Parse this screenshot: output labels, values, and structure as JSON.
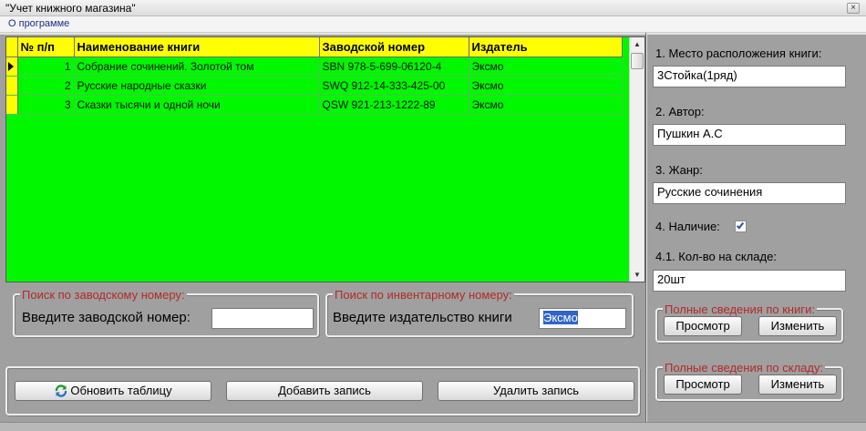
{
  "window": {
    "title": "\"Учет книжного магазина\"",
    "close_glyph": "×"
  },
  "menu": {
    "items": [
      "О программе"
    ]
  },
  "grid": {
    "columns": [
      "№ п/п",
      "Наименование книги",
      "Заводской номер",
      "Издатель"
    ],
    "rows": [
      [
        "1",
        "Собрание сочинений. Золотой том",
        "SBN 978-5-699-06120-4",
        "Эксмо"
      ],
      [
        "2",
        "Русские народные сказки",
        "SWQ 912-14-333-425-00",
        "Эксмо"
      ],
      [
        "3",
        "Сказки тысячи и одной ночи",
        "QSW 921-213-1222-89",
        "Эксмо"
      ]
    ],
    "colors": {
      "background": "#00f700",
      "header": "#ffff00"
    }
  },
  "search_factory": {
    "legend": "Поиск по заводскому номеру:",
    "label": "Введите заводской номер:",
    "value": ""
  },
  "search_publisher": {
    "legend": "Поиск по инвентарному номеру:",
    "label": "Введите издательство книги",
    "value": "Эксмо"
  },
  "actions": {
    "refresh": "Обновить таблицу",
    "add": "Добавить запись",
    "delete": "Удалить запись"
  },
  "details": {
    "location_label": "1. Место расположения книги:",
    "location_value": "3Стойка(1ряд)",
    "author_label": "2. Автор:",
    "author_value": "Пушкин А.С",
    "genre_label": "3. Жанр:",
    "genre_value": "Русские сочинения",
    "availability_label": "4. Наличие:",
    "availability_checked": true,
    "stock_label": "4.1. Кол-во на складе:",
    "stock_value": "20шт"
  },
  "book_info": {
    "legend": "Полные сведения по книги:",
    "view": "Просмотр",
    "edit": "Изменить"
  },
  "stock_info": {
    "legend": "Полные сведения по складу:",
    "view": "Просмотр",
    "edit": "Изменить"
  },
  "icons": {
    "refresh": "refresh-icon",
    "row_pointer": "row-pointer-icon",
    "close": "close-icon",
    "checkbox": "checkmark-icon"
  }
}
